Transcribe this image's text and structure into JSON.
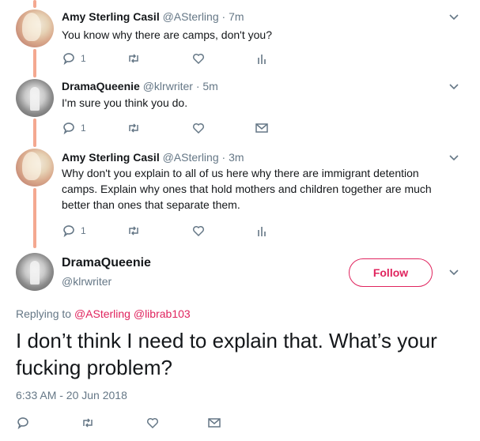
{
  "tweets": [
    {
      "name": "Amy Sterling Casil",
      "handle": "@ASterling",
      "dot": "·",
      "time": "7m",
      "text": "You know why there are camps, don't you?",
      "reply_count": "1"
    },
    {
      "name": "DramaQueenie",
      "handle": "@klrwriter",
      "dot": "·",
      "time": "5m",
      "text": "I'm sure you think you do.",
      "reply_count": "1"
    },
    {
      "name": "Amy Sterling Casil",
      "handle": "@ASterling",
      "dot": "·",
      "time": "3m",
      "text": "Why don't you explain to all of us here why there are immigrant detention camps. Explain why ones that hold mothers and children together are much better than ones that separate them.",
      "reply_count": "1"
    }
  ],
  "main": {
    "name": "DramaQueenie",
    "handle": "@klrwriter",
    "follow_label": "Follow",
    "replying_prefix": "Replying to",
    "replying_to": [
      "@ASterling",
      "@librab103"
    ],
    "text": "I don’t think I need to explain that. What’s your fucking problem?",
    "timestamp": "6:33 AM - 20 Jun 2018"
  },
  "icons": {
    "reply": "reply-icon",
    "retweet": "retweet-icon",
    "like": "heart-icon",
    "analytics": "analytics-icon",
    "dm": "envelope-icon",
    "more": "chevron-down-icon"
  },
  "colors": {
    "accent": "#e0245e",
    "thread_line": "#f4a890",
    "secondary_text": "#657786"
  }
}
